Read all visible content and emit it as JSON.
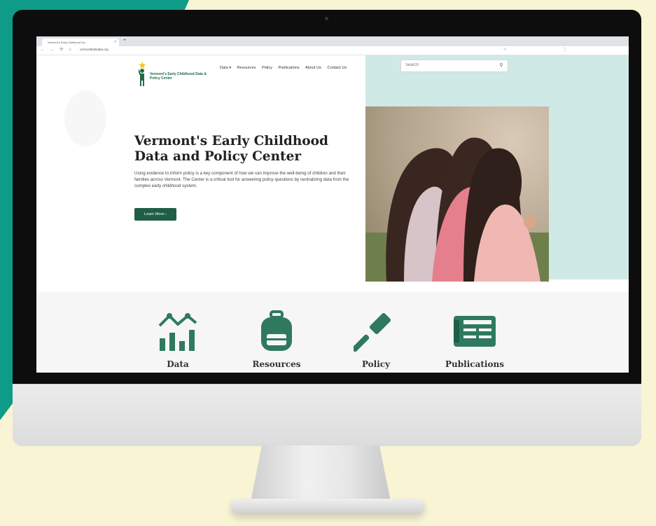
{
  "browser": {
    "tab_title": "Vermont's Early Childhood Da...",
    "tab_close": "×",
    "new_tab": "+",
    "url": "vermontkidsdata.org"
  },
  "site": {
    "logo_text": "Vermont's Early Childhood Data & Policy Center",
    "nav": [
      "Data ▾",
      "Resources",
      "Policy",
      "Publications",
      "About Us",
      "Contact Us"
    ],
    "search_placeholder": "Search"
  },
  "hero": {
    "title": "Vermont's Early Childhood Data and Policy Center",
    "body": "Using evidence to inform policy is a key component of how we can improve the well-being of children and their families across Vermont. The Center is a critical tool for answering policy questions by centralizing data from the complex early childhood system.",
    "button": "Learn More ›"
  },
  "features": [
    {
      "label": "Data",
      "icon": "bar-chart-icon"
    },
    {
      "label": "Resources",
      "icon": "backpack-icon"
    },
    {
      "label": "Policy",
      "icon": "gavel-icon"
    },
    {
      "label": "Publications",
      "icon": "newspaper-icon"
    }
  ],
  "colors": {
    "brand_green": "#1f5e45",
    "icon_green": "#2f7a5e",
    "accent_teal": "#cfe9e6",
    "background": "#f8f4d4",
    "decor_teal": "#0e9c88"
  }
}
